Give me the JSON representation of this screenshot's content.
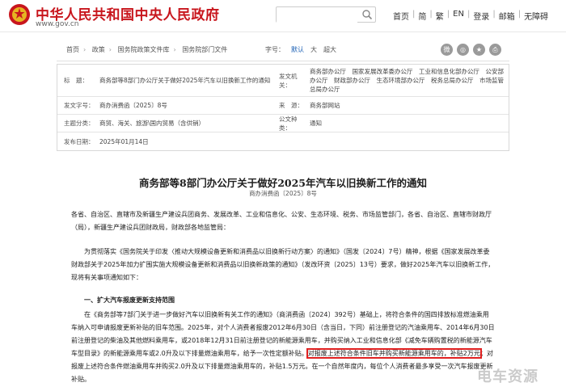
{
  "header": {
    "site_title": "中华人民共和国中央人民政府",
    "site_url": "www.gov.cn",
    "search_placeholder": "",
    "nav": [
      "首页",
      "简",
      "繁",
      "EN",
      "登录",
      "邮箱",
      "无障碍"
    ],
    "colors": {
      "brand": "#c8161d"
    }
  },
  "toolbar": {
    "breadcrumbs": [
      "首页",
      "政策",
      "国务院政策文件库",
      "国务院部门文件"
    ],
    "font_label": "字号：",
    "font_options": [
      "默认",
      "大",
      "超大"
    ],
    "active_font": "默认",
    "share_icons": [
      "weibo-icon",
      "wechat-icon",
      "qzone-icon",
      "print-icon"
    ]
  },
  "meta": {
    "title_label": "标　题：",
    "title_value": "商务部等8部门办公厅关于做好2025年汽车以旧换新工作的通知",
    "org_label": "发文机关：",
    "org_value": "商务部办公厅　国家发展改革委办公厅　工业和信息化部办公厅　公安部办公厅　财政部办公厅　生态环境部办公厅　税务总局办公厅　市场监管总局办公厅",
    "docno_label": "发文字号：",
    "docno_value": "商办消费函〔2025〕8号",
    "source_label": "来　源：",
    "source_value": "商务部网站",
    "topic_label": "主题分类：",
    "topic_value": "商贸、海关、旅游\\国内贸易（含供销）",
    "type_label": "公文种类：",
    "type_value": "通知",
    "date_label": "发布日期：",
    "date_value": "2025年01月14日"
  },
  "article": {
    "title": "商务部等8部门办公厅关于做好2025年汽车以旧换新工作的通知",
    "docno": "商办消费函〔2025〕8号",
    "addressees": "各省、自治区、直辖市及新疆生产建设兵团商务、发展改革、工业和信息化、公安、生态环境、税务、市场监管部门，各省、自治区、直辖市财政厅（局），新疆生产建设兵团财政局，财政部各地监管局：",
    "intro": "为贯彻落实《国务院关于印发〈推动大规模设备更新和消费品以旧换新行动方案〉的通知》（国发〔2024〕7号）精神，根据《国家发展改革委 财政部关于2025年加力扩围实施大规模设备更新和消费品以旧换新政策的通知》（发改环资〔2025〕13号）要求，做好2025年汽车以旧换新工作，现将有关事项通知如下：",
    "heading1": "一、扩大汽车报废更新支持范围",
    "body_part1": "在《商务部等7部门关于进一步做好汽车以旧换新有关工作的通知》（商消费函〔2024〕392号）基础上，将符合条件的国四排放标准燃油乘用车纳入可申请报废更新补贴的旧车范围。2025年，对个人消费者报废2012年6月30日（含当日，下同）前注册登记的汽油乘用车、2014年6月30日前注册登记的柴油及其他燃料乘用车，或2018年12月31日前注册登记的新能源乘用车，并购买纳入工业和信息化部《减免车辆购置税的新能源汽车车型目录》的新能源乘用车或2.0升及以下排量燃油乘用车，给予一次性定额补贴。",
    "body_highlight": "对报废上述符合条件旧车并购买新能源乘用车的，补贴2万元",
    "body_part2": "；对报废上述符合条件燃油乘用车并购买2.0升及以下排量燃油乘用车的，补贴1.5万元。在一个自然年度内，每位个人消费者最多享受一次汽车报废更新补贴。",
    "highlight_color": "#e02020"
  },
  "watermark": "电车资源"
}
